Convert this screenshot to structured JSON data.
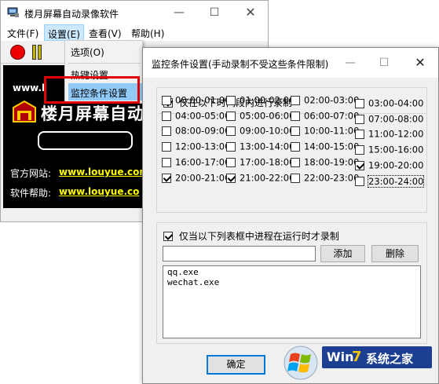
{
  "main_window": {
    "title": "楼月屏幕自动录像软件",
    "controls": {
      "minimize": "—",
      "maximize": "☐",
      "close": "✕"
    },
    "menu": [
      "文件(F)",
      "设置(E)",
      "查看(V)",
      "帮助(H)"
    ],
    "dropdown": {
      "options_label": "选项(O)",
      "hotkey_label": "热键设置",
      "monitor_label": "监控条件设置"
    },
    "banner": {
      "site_prefix": "www.l",
      "name_line": "楼月屏幕自动录",
      "official_label": "官方网站:",
      "official_url": "www.louyue.com",
      "help_label": "软件帮助:",
      "help_url": "www.louyue.co"
    }
  },
  "dialog": {
    "title": "监控条件设置(手动录制不受这些条件限制)",
    "controls": {
      "minimize": "—",
      "maximize": "☐",
      "close": "✕"
    },
    "time_section": {
      "label": "仅在以下时间段内进行录制",
      "checked": true,
      "slots": [
        {
          "label": "00:00-01:00",
          "checked": false
        },
        {
          "label": "01:00-02:00",
          "checked": false
        },
        {
          "label": "02:00-03:00",
          "checked": false
        },
        {
          "label": "03:00-04:00",
          "checked": false
        },
        {
          "label": "04:00-05:00",
          "checked": false
        },
        {
          "label": "05:00-06:00",
          "checked": false
        },
        {
          "label": "06:00-07:00",
          "checked": false
        },
        {
          "label": "07:00-08:00",
          "checked": false
        },
        {
          "label": "08:00-09:00",
          "checked": false
        },
        {
          "label": "09:00-10:00",
          "checked": false
        },
        {
          "label": "10:00-11:00",
          "checked": false
        },
        {
          "label": "11:00-12:00",
          "checked": false
        },
        {
          "label": "12:00-13:00",
          "checked": false
        },
        {
          "label": "13:00-14:00",
          "checked": false
        },
        {
          "label": "14:00-15:00",
          "checked": false
        },
        {
          "label": "15:00-16:00",
          "checked": false
        },
        {
          "label": "16:00-17:00",
          "checked": false
        },
        {
          "label": "17:00-18:00",
          "checked": false
        },
        {
          "label": "18:00-19:00",
          "checked": false
        },
        {
          "label": "19:00-20:00",
          "checked": true
        },
        {
          "label": "20:00-21:00",
          "checked": true
        },
        {
          "label": "21:00-22:00",
          "checked": true
        },
        {
          "label": "22:00-23:00",
          "checked": false
        },
        {
          "label": "23:00-24:00",
          "checked": false
        }
      ]
    },
    "process_section": {
      "label": "仅当以下列表框中进程在运行时才录制",
      "checked": true,
      "input_value": "",
      "add_label": "添加",
      "delete_label": "删除",
      "processes": [
        "qq.exe",
        "wechat.exe"
      ]
    },
    "ok_label": "确定"
  },
  "watermark": {
    "text_a": "Win",
    "text_b": "7",
    "text_c": "系统之家"
  },
  "colors": {
    "accent": "#0078d7",
    "highlight_box": "#e00000",
    "menu_selected": "#91c9f7",
    "link": "#ffff00"
  }
}
